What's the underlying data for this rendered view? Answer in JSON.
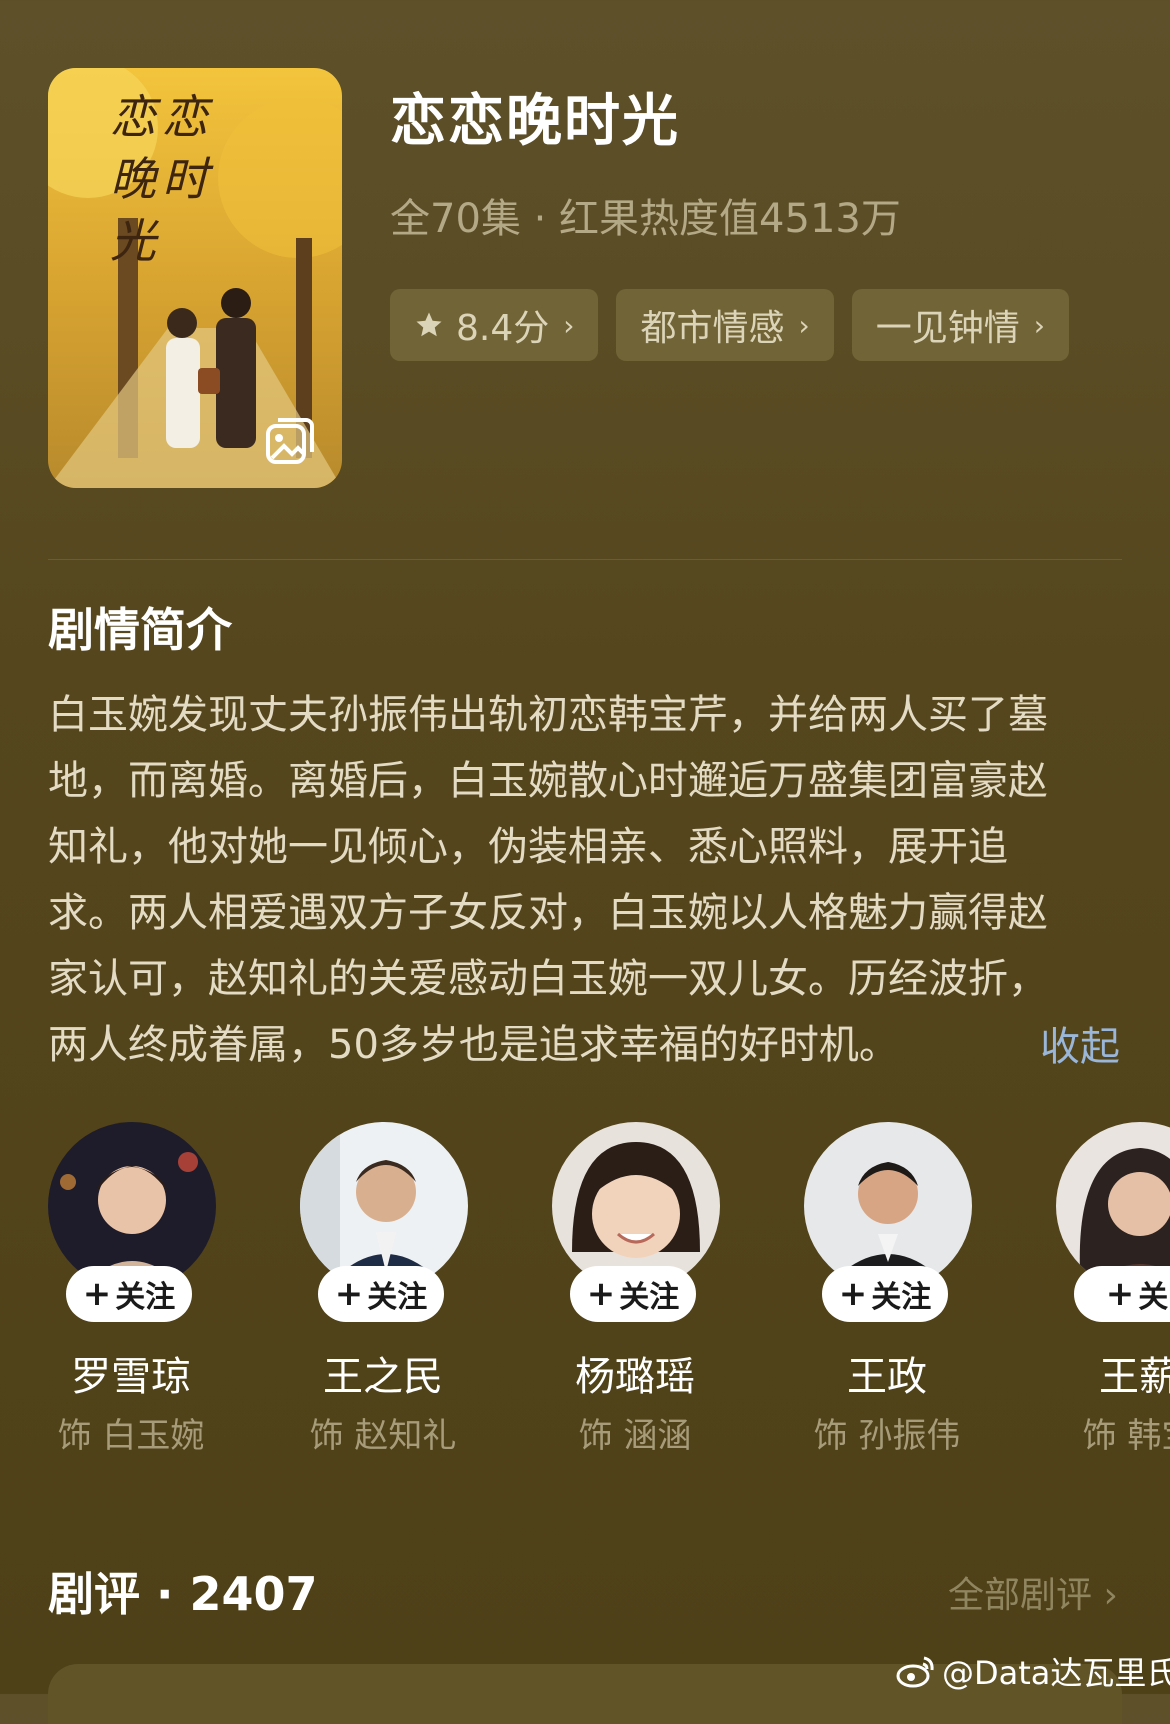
{
  "show": {
    "title": "恋恋晚时光",
    "meta": "全70集 · 红果热度值4513万",
    "poster_title": "恋恋晚时光"
  },
  "tags": [
    {
      "label": "8.4分",
      "icon": "star-icon"
    },
    {
      "label": "都市情感"
    },
    {
      "label": "一见钟情"
    }
  ],
  "synopsis": {
    "heading": "剧情简介",
    "lines": [
      "白玉婉发现丈夫孙振伟出轨初恋韩宝芹，并给两人买了墓",
      "地，而离婚。离婚后，白玉婉散心时邂逅万盛集团富豪赵",
      "知礼，他对她一见倾心，伪装相亲、悉心照料，展开追",
      "求。两人相爱遇双方子女反对，白玉婉以人格魅力赢得赵",
      "家认可，赵知礼的关爱感动白玉婉一双儿女。历经波折，",
      "两人终成眷属，50多岁也是追求幸福的好时机。"
    ],
    "collapse_label": "收起"
  },
  "cast": [
    {
      "name": "罗雪琼",
      "role": "饰 白玉婉",
      "follow": "关注"
    },
    {
      "name": "王之民",
      "role": "饰 赵知礼",
      "follow": "关注"
    },
    {
      "name": "杨璐瑶",
      "role": "饰 涵涵",
      "follow": "关注"
    },
    {
      "name": "王政",
      "role": "饰 孙振伟",
      "follow": "关注"
    },
    {
      "name": "王薪",
      "role": "饰 韩宝",
      "follow": "关"
    }
  ],
  "reviews": {
    "title": "剧评 · 2407",
    "all_label": "全部剧评"
  },
  "watermark": "@Data达瓦里氏",
  "colors": {
    "background": "#55461d",
    "tag_bg": "#716537",
    "link_blue": "#9ab6d8"
  }
}
